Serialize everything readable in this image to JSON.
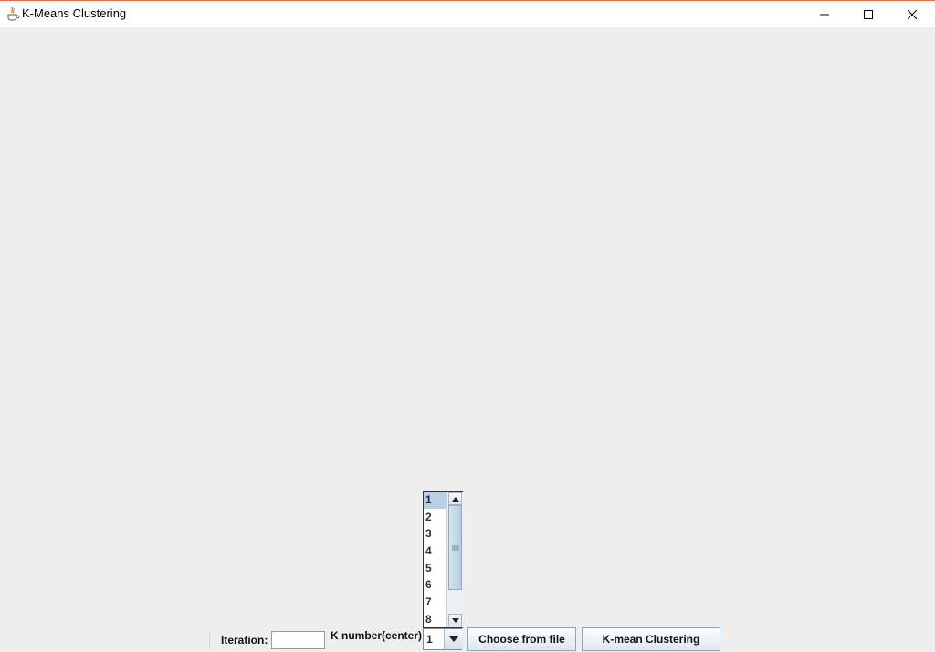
{
  "window": {
    "title": "K-Means Clustering",
    "accent_color": "#e0714c",
    "icon": "java-icon"
  },
  "controls": {
    "iteration_label": "Iteration:",
    "iteration_value": "",
    "k_label": "K number(center)",
    "k_selected": "1",
    "k_options": [
      "1",
      "2",
      "3",
      "4",
      "5",
      "6",
      "7",
      "8"
    ],
    "choose_file_label": "Choose from file",
    "cluster_label": "K-mean Clustering"
  }
}
